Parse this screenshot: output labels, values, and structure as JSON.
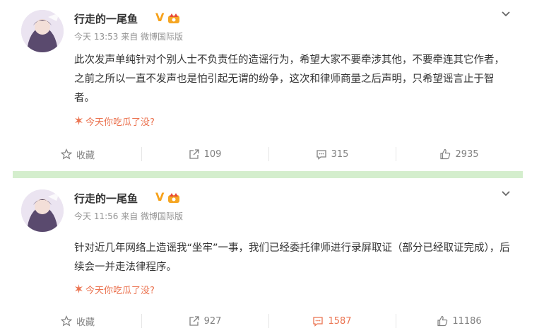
{
  "posts": [
    {
      "author": "行走的一尾鱼",
      "verified_mark": "V",
      "time": "今天 13:53",
      "source": "来自 微博国际版",
      "content": "此次发声单纯针对个别人士不负责任的造谣行为，希望大家不要牵涉其他，不要牵连其它作者，之前之所以一直不发声也是怕引起无谓的纷争，这次和律师商量之后声明，只希望谣言止于智者。",
      "topic": "今天你吃瓜了没?",
      "actions": {
        "favorite": "收藏",
        "repost": "109",
        "comment": "315",
        "like": "2935"
      }
    },
    {
      "author": "行走的一尾鱼",
      "verified_mark": "V",
      "time": "今天 11:56",
      "source": "来自 微博国际版",
      "content": "针对近几年网络上造谣我“坐牢”一事，我们已经委托律师进行录屏取证（部分已经取证完成），后续会一并走法律程序。",
      "topic": "今天你吃瓜了没?",
      "actions": {
        "favorite": "收藏",
        "repost": "927",
        "comment": "1587",
        "like": "11186"
      }
    }
  ],
  "colors": {
    "accent": "#eb7350",
    "verified": "#f7a21b",
    "divider": "#d4eecd",
    "muted": "#939393"
  },
  "icons": [
    "avatar",
    "verified-badge",
    "vip-crown-icon",
    "chevron-down-icon",
    "star-icon",
    "repost-icon",
    "comment-icon",
    "like-icon",
    "topic-icon"
  ]
}
